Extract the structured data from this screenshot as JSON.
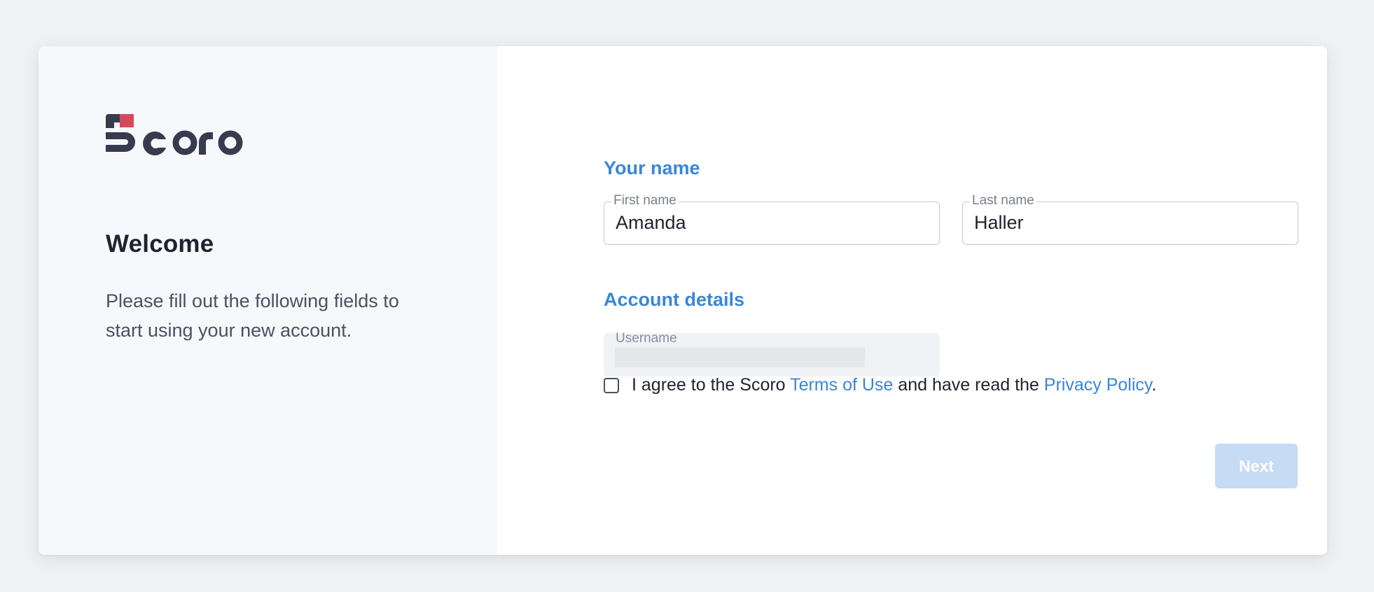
{
  "brand": {
    "logo_text": "Scoro",
    "logo_color": "#363b4d",
    "logo_accent": "#d6495a"
  },
  "welcome": {
    "title": "Welcome",
    "text": "Please fill out the following fields to start using your new account."
  },
  "your_name": {
    "section_title": "Your name",
    "first_name": {
      "label": "First name",
      "value": "Amanda"
    },
    "last_name": {
      "label": "Last name",
      "value": "Haller"
    }
  },
  "account_details": {
    "section_title": "Account details",
    "username": {
      "label": "Username",
      "value": "",
      "state": "loading"
    }
  },
  "agreement": {
    "prefix": "I agree to the Scoro ",
    "terms_link": "Terms of Use",
    "middle": " and have read the ",
    "privacy_link": "Privacy Policy",
    "suffix": ".",
    "checked": false
  },
  "actions": {
    "next_label": "Next",
    "next_enabled": false
  },
  "colors": {
    "accent": "#3a86d6",
    "button_disabled": "#c6dbf4",
    "page_bg": "#f0f1f5",
    "left_panel_bg": "#f7f8fc"
  }
}
